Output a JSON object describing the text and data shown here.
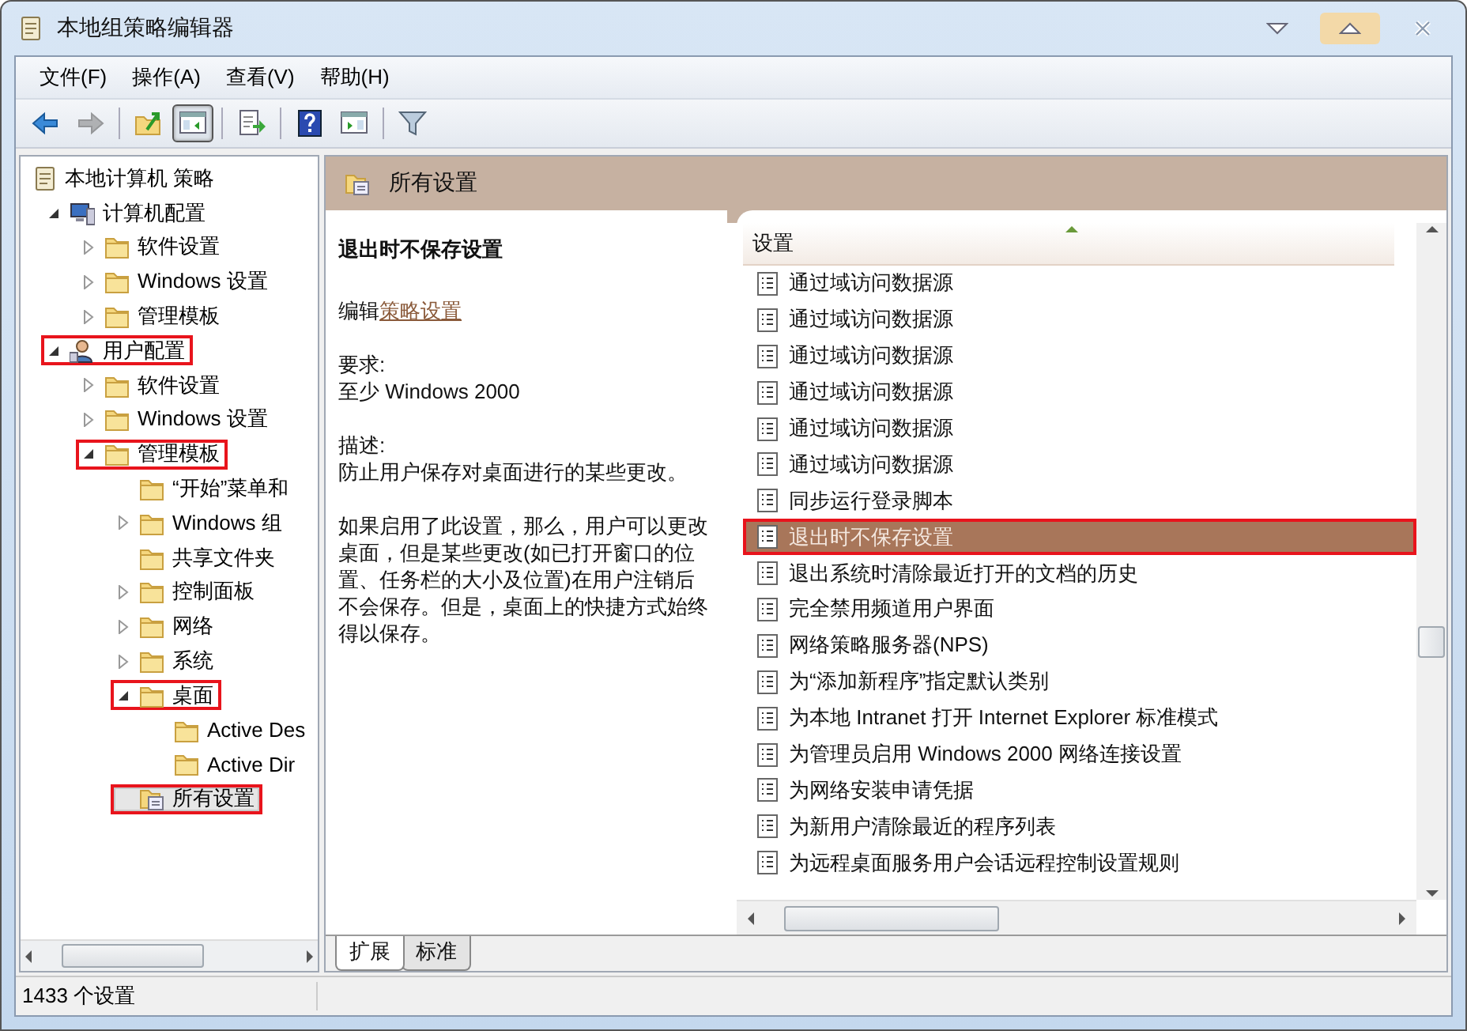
{
  "window": {
    "title": "本地组策略编辑器"
  },
  "menu": [
    "文件(F)",
    "操作(A)",
    "查看(V)",
    "帮助(H)"
  ],
  "toolbar": [
    {
      "pressed": false,
      "disabled": false
    },
    {
      "pressed": false,
      "disabled": true
    },
    {
      "pressed": false,
      "disabled": false
    },
    {
      "pressed": true,
      "disabled": false
    },
    {
      "pressed": false,
      "disabled": false
    },
    {
      "pressed": false,
      "disabled": false
    },
    {
      "pressed": false,
      "disabled": false
    },
    {
      "pressed": false,
      "disabled": false
    }
  ],
  "tree": [
    {
      "label": "本地计算机 策略",
      "kind": "policy",
      "selected": false,
      "highlighted": false,
      "children": [
        {
          "label": "计算机配置",
          "kind": "computer",
          "expanded": true,
          "selected": false,
          "highlighted": false,
          "children": [
            {
              "label": "软件设置",
              "kind": "folder",
              "expanded": false,
              "selected": false,
              "highlighted": false
            },
            {
              "label": "Windows 设置",
              "kind": "folder",
              "expanded": false,
              "selected": false,
              "highlighted": false
            },
            {
              "label": "管理模板",
              "kind": "folder",
              "expanded": false,
              "selected": false,
              "highlighted": false
            }
          ]
        },
        {
          "label": "用户配置",
          "kind": "user",
          "expanded": true,
          "selected": false,
          "highlighted": true,
          "children": [
            {
              "label": "软件设置",
              "kind": "folder",
              "expanded": false,
              "selected": false,
              "highlighted": false
            },
            {
              "label": "Windows 设置",
              "kind": "folder",
              "expanded": false,
              "selected": false,
              "highlighted": false
            },
            {
              "label": "管理模板",
              "kind": "folder",
              "expanded": true,
              "selected": false,
              "highlighted": true,
              "children": [
                {
                  "label": "“开始”菜单和",
                  "kind": "folder",
                  "selected": false,
                  "highlighted": false
                },
                {
                  "label": "Windows 组",
                  "kind": "folder",
                  "expanded": false,
                  "selected": false,
                  "highlighted": false
                },
                {
                  "label": "共享文件夹",
                  "kind": "folder",
                  "selected": false,
                  "highlighted": false
                },
                {
                  "label": "控制面板",
                  "kind": "folder",
                  "expanded": false,
                  "selected": false,
                  "highlighted": false
                },
                {
                  "label": "网络",
                  "kind": "folder",
                  "expanded": false,
                  "selected": false,
                  "highlighted": false
                },
                {
                  "label": "系统",
                  "kind": "folder",
                  "expanded": false,
                  "selected": false,
                  "highlighted": false
                },
                {
                  "label": "桌面",
                  "kind": "folder",
                  "expanded": true,
                  "selected": false,
                  "highlighted": true,
                  "children": [
                    {
                      "label": "Active Des",
                      "kind": "folder",
                      "selected": false,
                      "highlighted": false
                    },
                    {
                      "label": "Active Dir",
                      "kind": "folder",
                      "selected": false,
                      "highlighted": false
                    }
                  ]
                },
                {
                  "label": "所有设置",
                  "kind": "settings",
                  "selected": true,
                  "highlighted": true
                }
              ]
            }
          ]
        }
      ]
    }
  ],
  "detail": {
    "heading": "所有设置",
    "setting_title": "退出时不保存设置",
    "edit_label": "编辑",
    "edit_link": "策略设置",
    "requirement_label": "要求:",
    "requirement": "至少 Windows 2000",
    "description_label": "描述:",
    "paragraphs": [
      "防止用户保存对桌面进行的某些更改。",
      "如果启用了此设置，那么，用户可以更改桌面，但是某些更改(如已打开窗口的位置、任务栏的大小及位置)在用户注销后不会保存。但是，桌面上的快捷方式始终得以保存。"
    ]
  },
  "list": {
    "column": "设置",
    "rows": [
      {
        "label": "通过域访问数据源",
        "selected": false,
        "highlighted": false
      },
      {
        "label": "通过域访问数据源",
        "selected": false,
        "highlighted": false
      },
      {
        "label": "通过域访问数据源",
        "selected": false,
        "highlighted": false
      },
      {
        "label": "通过域访问数据源",
        "selected": false,
        "highlighted": false
      },
      {
        "label": "通过域访问数据源",
        "selected": false,
        "highlighted": false
      },
      {
        "label": "通过域访问数据源",
        "selected": false,
        "highlighted": false
      },
      {
        "label": "同步运行登录脚本",
        "selected": false,
        "highlighted": false
      },
      {
        "label": "退出时不保存设置",
        "selected": true,
        "highlighted": true
      },
      {
        "label": "退出系统时清除最近打开的文档的历史",
        "selected": false,
        "highlighted": false
      },
      {
        "label": "完全禁用频道用户界面",
        "selected": false,
        "highlighted": false
      },
      {
        "label": "网络策略服务器(NPS)",
        "selected": false,
        "highlighted": false
      },
      {
        "label": "为“添加新程序”指定默认类别",
        "selected": false,
        "highlighted": false
      },
      {
        "label": "为本地 Intranet 打开 Internet Explorer 标准模式",
        "selected": false,
        "highlighted": false
      },
      {
        "label": "为管理员启用 Windows 2000 网络连接设置",
        "selected": false,
        "highlighted": false
      },
      {
        "label": "为网络安装申请凭据",
        "selected": false,
        "highlighted": false
      },
      {
        "label": "为新用户清除最近的程序列表",
        "selected": false,
        "highlighted": false
      },
      {
        "label": "为远程桌面服务用户会话远程控制设置规则",
        "selected": false,
        "highlighted": false
      }
    ]
  },
  "tabs": [
    {
      "label": "扩展",
      "selected": true
    },
    {
      "label": "标准",
      "selected": false
    }
  ],
  "status_bar": "1433 个设置"
}
